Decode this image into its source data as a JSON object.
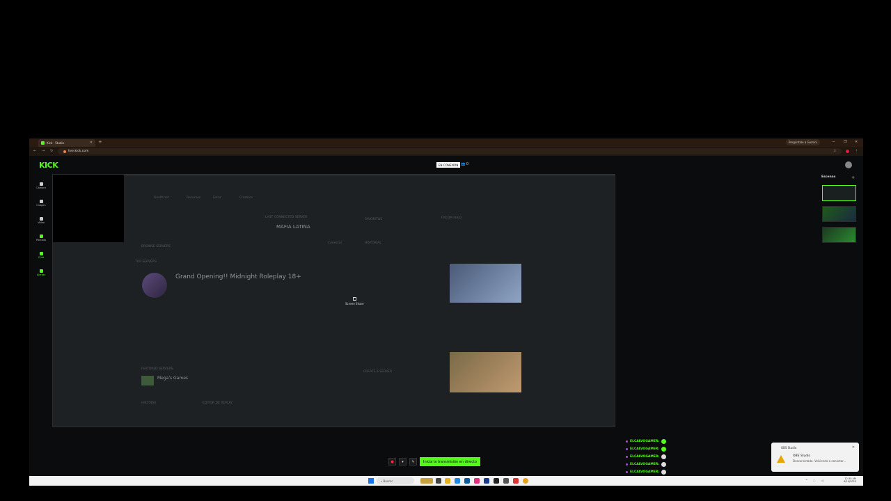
{
  "browser": {
    "tab_title": "Kick - Studio",
    "url": "live.kick.com",
    "gemini_label": "Pregúntale a Gemini"
  },
  "kick": {
    "logo": "KICK",
    "live_badge": "EN CONEXIÓN",
    "viewers": "0"
  },
  "sidebar": {
    "items": [
      {
        "label": "Cámara"
      },
      {
        "label": "Imagen"
      },
      {
        "label": "Video"
      },
      {
        "label": "Pantalla"
      },
      {
        "label": "Chat"
      },
      {
        "label": "Alertas"
      }
    ]
  },
  "preview": {
    "nav": [
      "FiveM.net",
      "Recursos",
      "Foros",
      "Creators"
    ],
    "last_server_label": "LAST CONNECTED SERVER",
    "last_server_name": "MAFIA LATINA",
    "connect": "Conectar",
    "favorites": "FAVORITOS",
    "history": "HISTORIAL",
    "top_servers": "TOP SERVERS",
    "featured_title": "Grand Opening!! Midnight Roleplay 18+",
    "browse": "BROWSE SERVERS",
    "feed": "FXCOM FEED",
    "featured_servers": "FEATURED SERVERS",
    "mega_games": "Mega's Games",
    "history2": "HISTORIA",
    "replay_editor": "EDITOR DE REPLAY",
    "create_server": "CREATE A SERVER",
    "stream_label": "Screen Share"
  },
  "scenes": {
    "title": "Escenas"
  },
  "chat": {
    "messages": [
      {
        "name": "ELCALVOGAMER:"
      },
      {
        "name": "ELCALVOGAMER:"
      },
      {
        "name": "ELCALVOGAMER:"
      },
      {
        "name": "ELCALVOGAMER:"
      },
      {
        "name": "ELCALVOGAMER:"
      }
    ]
  },
  "controls": {
    "start_label": "Inicia la transmisión en directo"
  },
  "toast": {
    "app": "OBS Studio",
    "title": "OBS Studio",
    "message": "Desconectado. Volviendo a conectar..."
  },
  "taskbar": {
    "search_placeholder": "Buscar",
    "time": "12:30 AM",
    "date": "8/19/2025"
  },
  "colors": {
    "kick_green": "#53fc18",
    "chat_purple": "#a64fe0",
    "warning": "#e6a700"
  }
}
